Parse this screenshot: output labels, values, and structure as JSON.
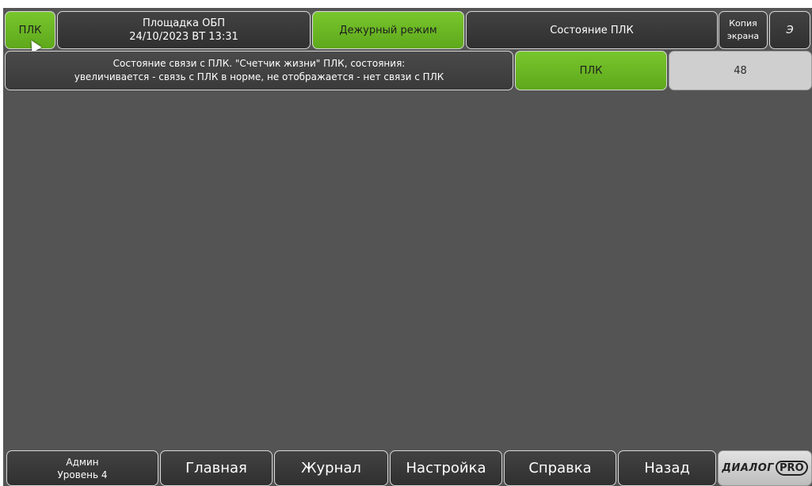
{
  "header": {
    "plc_button": "ПЛК",
    "site_name": "Площадка ОБП",
    "datetime": "24/10/2023 ВТ 13:31",
    "mode": "Дежурный режим",
    "screen_title": "Состояние ПЛК",
    "copy_line1": "Копия",
    "copy_line2": "экрана",
    "extra": "Э"
  },
  "status_row": {
    "description_line1": "Состояние связи с ПЛК. \"Счетчик жизни\" ПЛК, состояния:",
    "description_line2": "увеличивается - связь с ПЛК в норме, не отображается - нет связи с ПЛК",
    "plc_indicator": "ПЛК",
    "life_counter": "48"
  },
  "footer": {
    "user_name": "Админ",
    "user_level": "Уровень 4",
    "nav": [
      "Главная",
      "Журнал",
      "Настройка",
      "Справка",
      "Назад"
    ],
    "logo_text": "ДИАЛОГ",
    "logo_pro": "PRO"
  },
  "colors": {
    "active_green": "#6ab824",
    "background": "#545454",
    "button_dark": "#363636"
  }
}
